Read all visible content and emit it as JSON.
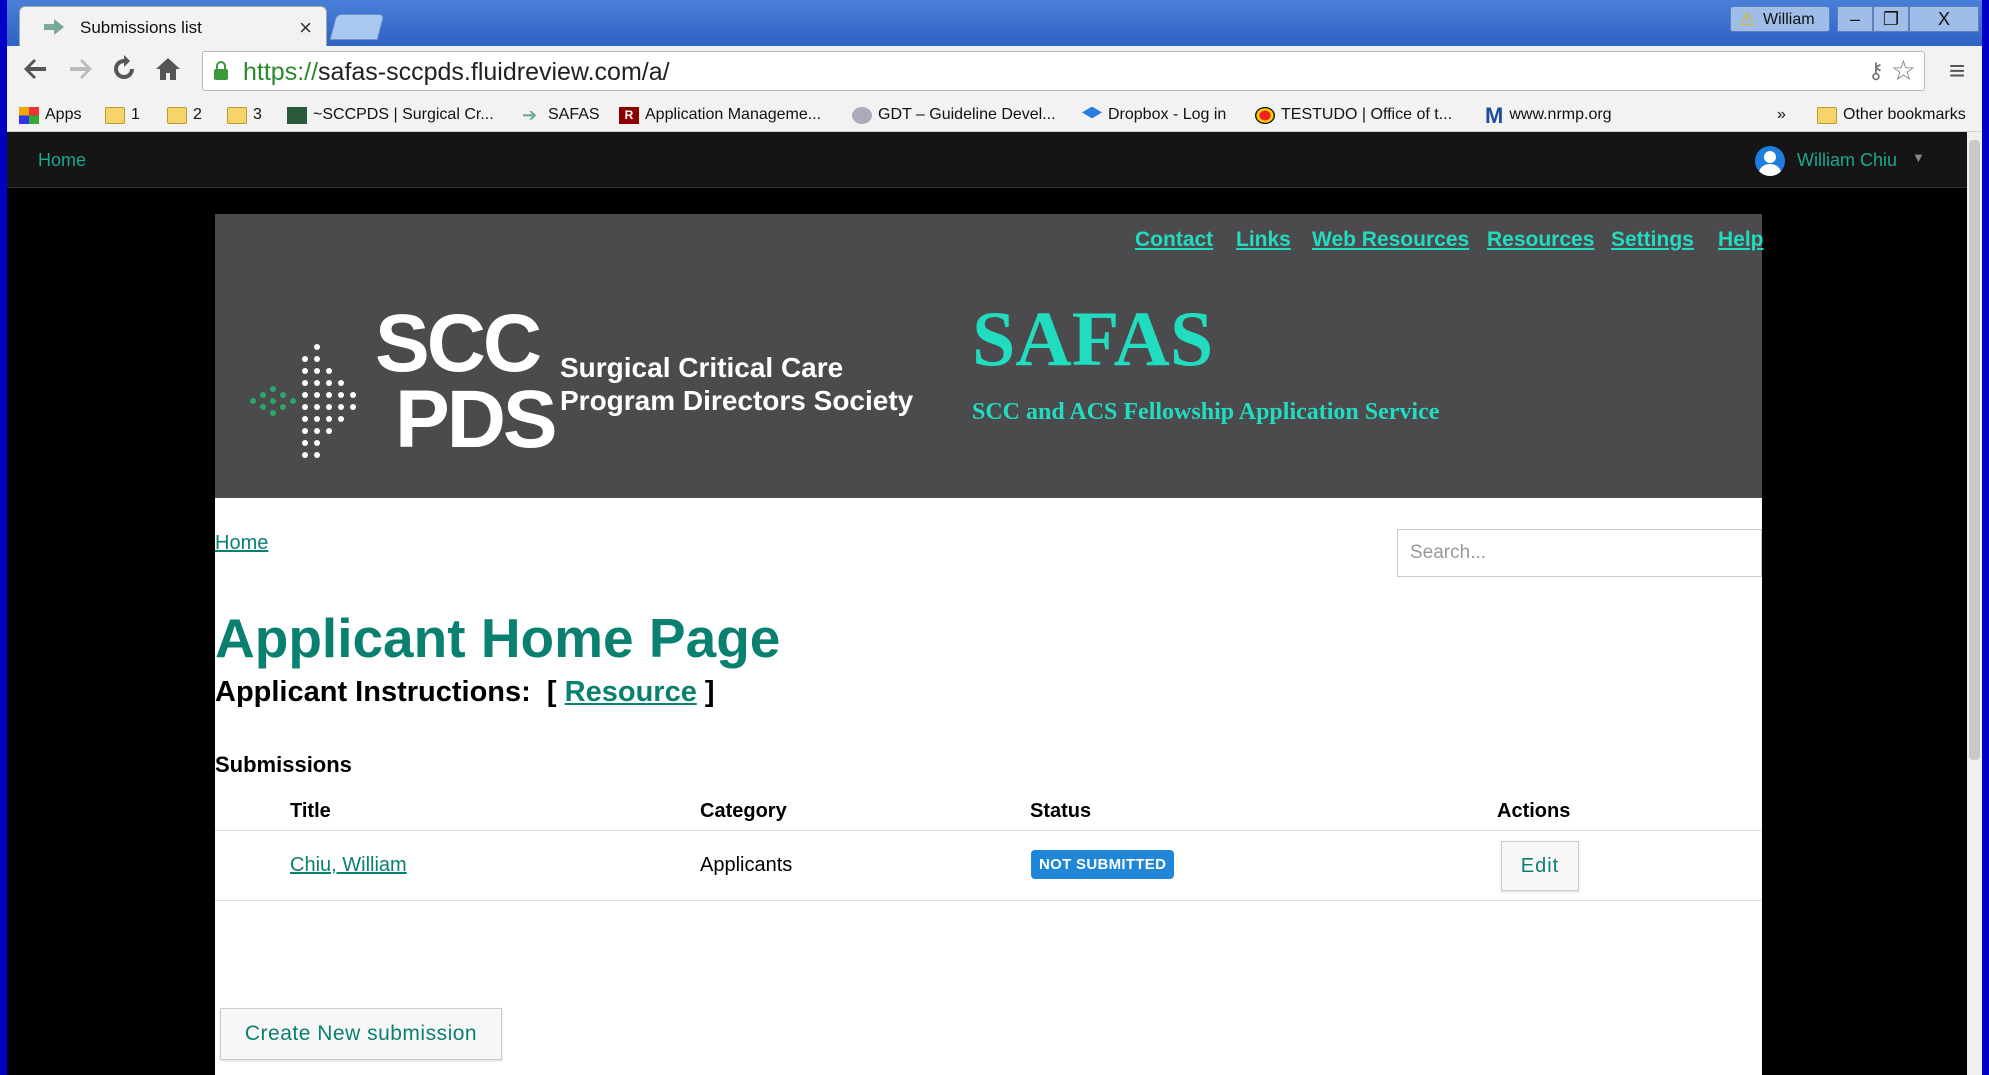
{
  "browser": {
    "tab_title": "Submissions list",
    "tab_close": "×",
    "profile_name": "William",
    "window_min": "–",
    "window_max": "❐",
    "window_close": "X",
    "url_scheme": "https://",
    "url_rest": "safas-sccpds.fluidreview.com/a/",
    "bookmarks": {
      "apps": "Apps",
      "f1": "1",
      "f2": "2",
      "f3": "3",
      "sccpds": "~SCCPDS | Surgical Cr...",
      "safas": "SAFAS",
      "appmgmt": "Application Manageme...",
      "gdt": "GDT – Guideline Devel...",
      "dropbox": "Dropbox - Log in",
      "testudo": "TESTUDO | Office of t...",
      "nrmp": "www.nrmp.org",
      "more": "»",
      "other": "Other bookmarks"
    }
  },
  "topnav": {
    "home": "Home",
    "user": "William Chiu"
  },
  "banner": {
    "links": {
      "contact": "Contact",
      "links": "Links",
      "web_resources": "Web Resources",
      "resources": "Resources",
      "settings": "Settings",
      "help": "Help"
    },
    "logo_scc": "SCC",
    "logo_pds": "PDS",
    "logo_society_line1": "Surgical Critical Care",
    "logo_society_line2": "Program Directors Society",
    "title": "SAFAS",
    "subtitle": "SCC and ACS Fellowship Application Service"
  },
  "main": {
    "breadcrumb": "Home",
    "search_placeholder": "Search...",
    "page_title": "Applicant Home Page",
    "instructions_label": "Applicant Instructions:",
    "instructions_open": "[",
    "instructions_link": "Resource",
    "instructions_close": "]",
    "submissions_heading": "Submissions",
    "table": {
      "headers": {
        "title": "Title",
        "category": "Category",
        "status": "Status",
        "actions": "Actions"
      },
      "rows": [
        {
          "title": "Chiu, William",
          "category": "Applicants",
          "status": "NOT SUBMITTED",
          "action": "Edit"
        }
      ]
    },
    "create_button": "Create New submission"
  },
  "colors": {
    "teal_link": "#0a8070",
    "banner_accent": "#22dcc0",
    "banner_bg": "#4b4b4d",
    "status_badge": "#2087d8"
  }
}
